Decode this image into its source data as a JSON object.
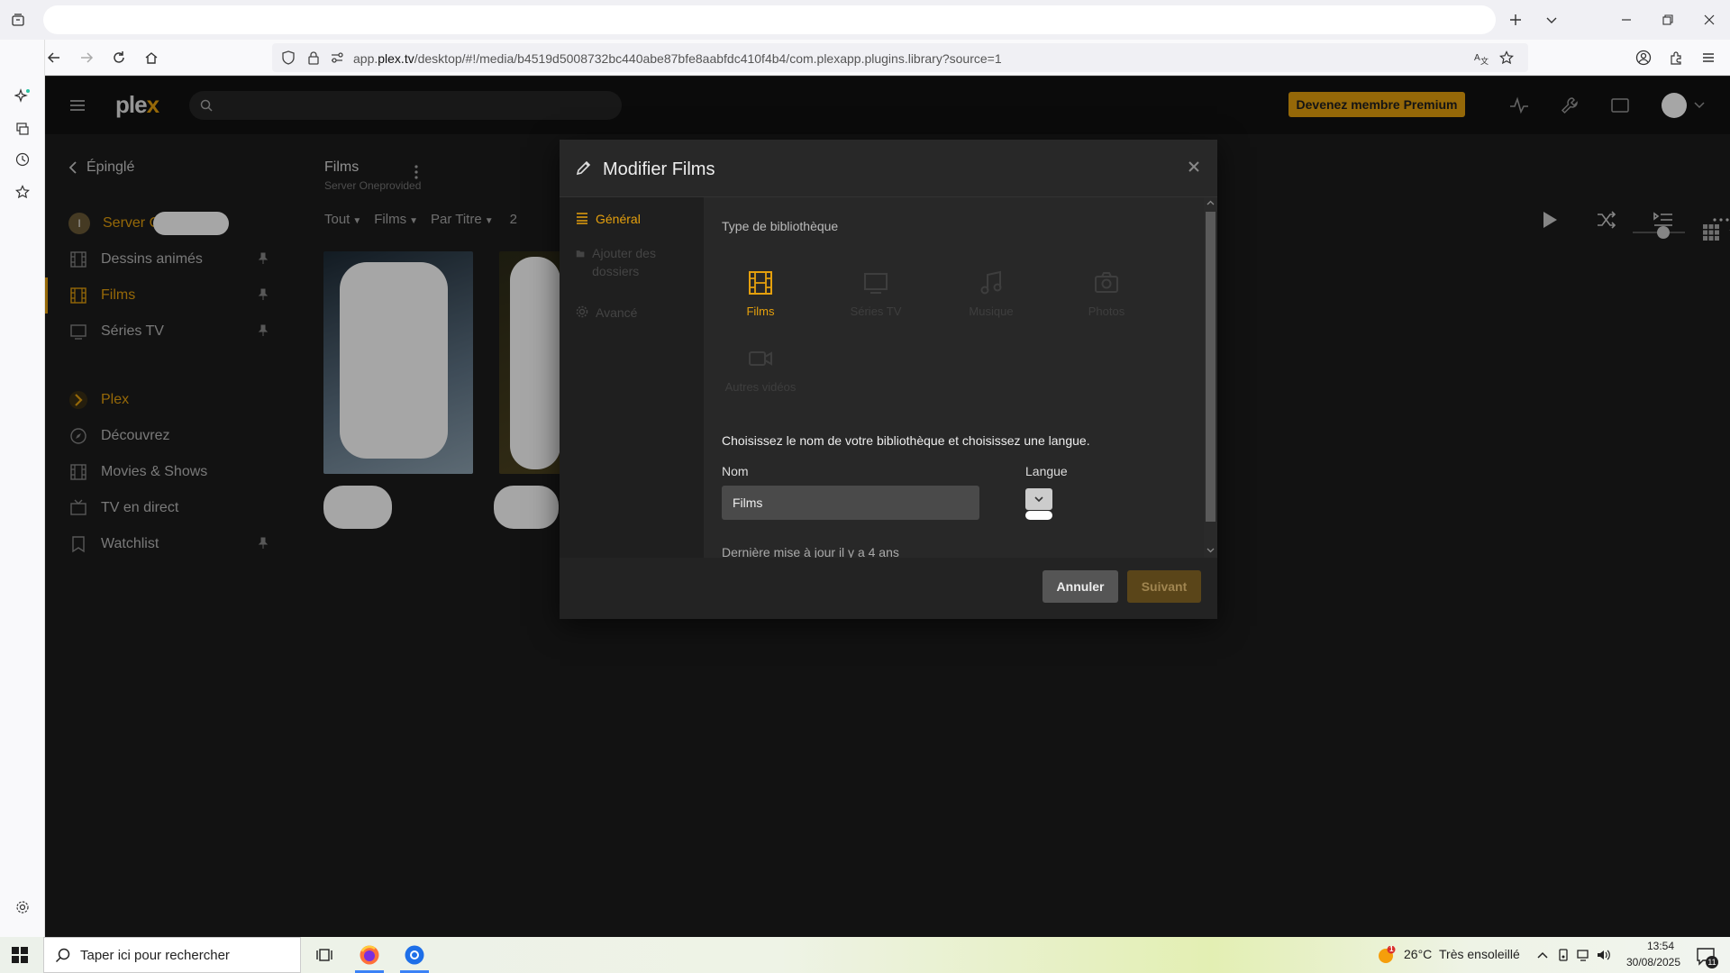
{
  "browser": {
    "url_prefix": "app.",
    "url_domain": "plex.tv",
    "url_rest": "/desktop/#!/media/b4519d5008732bc440abe87bfe8aabfdc410f4b4/com.plexapp.plugins.library?source=1"
  },
  "plex": {
    "logo_main": "ple",
    "logo_accent": "x",
    "premium_label": "Devenez membre Premium",
    "nav": {
      "pinned_label": "Épinglé",
      "server_initial": "I",
      "server_name": "Server O",
      "items": [
        {
          "label": "Dessins animés"
        },
        {
          "label": "Films"
        },
        {
          "label": "Séries TV"
        },
        {
          "label": "Plex"
        },
        {
          "label": "Découvrez"
        },
        {
          "label": "Movies & Shows"
        },
        {
          "label": "TV en direct"
        },
        {
          "label": "Watchlist"
        }
      ]
    },
    "library": {
      "title": "Films",
      "subtitle": "Server Oneprovided",
      "filters": {
        "all": "Tout",
        "type": "Films",
        "sort": "Par Titre",
        "count": "2"
      }
    }
  },
  "modal": {
    "title": "Modifier Films",
    "side": {
      "general": "Général",
      "add_folders": "Ajouter des dossiers",
      "advanced": "Avancé"
    },
    "library_type_label": "Type de bibliothèque",
    "types": [
      {
        "label": "Films",
        "icon": "film-icon",
        "selected": true
      },
      {
        "label": "Séries TV",
        "icon": "tv-icon",
        "selected": false
      },
      {
        "label": "Musique",
        "icon": "music-icon",
        "selected": false
      },
      {
        "label": "Photos",
        "icon": "camera-icon",
        "selected": false
      },
      {
        "label": "Autres vidéos",
        "icon": "video-icon",
        "selected": false
      }
    ],
    "instruction": "Choisissez le nom de votre bibliothèque et choisissez une langue.",
    "name_label": "Nom",
    "name_value": "Films",
    "language_label": "Langue",
    "last_update": "Dernière mise à jour il y a 4 ans",
    "cancel": "Annuler",
    "next": "Suivant"
  },
  "taskbar": {
    "search_placeholder": "Taper ici pour rechercher",
    "weather_temp": "26°C",
    "weather_desc": "Très ensoleillé",
    "weather_badge": "1",
    "time": "13:54",
    "date": "30/08/2025",
    "notif_count": "11"
  },
  "colors": {
    "accent": "#e5a00d",
    "background": "#1f1f1f"
  }
}
